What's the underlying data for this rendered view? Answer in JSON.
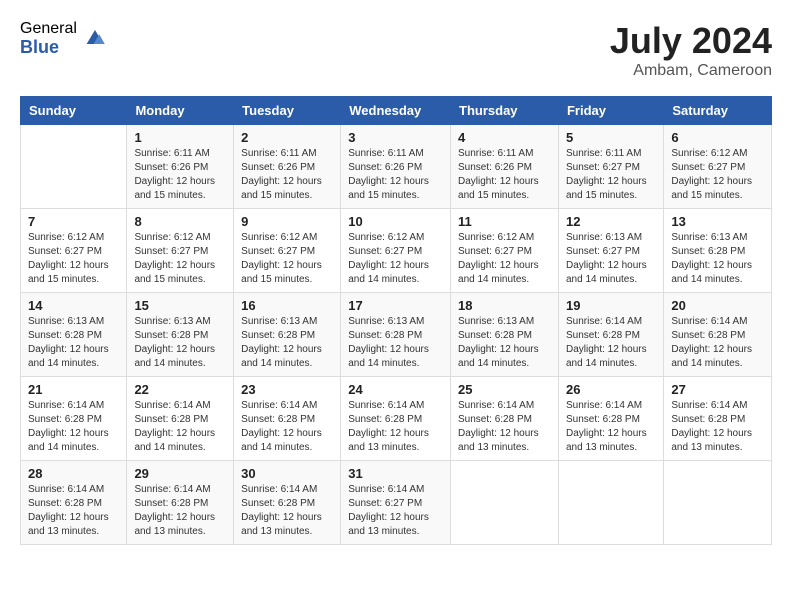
{
  "logo": {
    "general": "General",
    "blue": "Blue"
  },
  "title": "July 2024",
  "location": "Ambam, Cameroon",
  "days_of_week": [
    "Sunday",
    "Monday",
    "Tuesday",
    "Wednesday",
    "Thursday",
    "Friday",
    "Saturday"
  ],
  "weeks": [
    [
      {
        "day": "",
        "sunrise": "",
        "sunset": "",
        "daylight": ""
      },
      {
        "day": "1",
        "sunrise": "Sunrise: 6:11 AM",
        "sunset": "Sunset: 6:26 PM",
        "daylight": "Daylight: 12 hours and 15 minutes."
      },
      {
        "day": "2",
        "sunrise": "Sunrise: 6:11 AM",
        "sunset": "Sunset: 6:26 PM",
        "daylight": "Daylight: 12 hours and 15 minutes."
      },
      {
        "day": "3",
        "sunrise": "Sunrise: 6:11 AM",
        "sunset": "Sunset: 6:26 PM",
        "daylight": "Daylight: 12 hours and 15 minutes."
      },
      {
        "day": "4",
        "sunrise": "Sunrise: 6:11 AM",
        "sunset": "Sunset: 6:26 PM",
        "daylight": "Daylight: 12 hours and 15 minutes."
      },
      {
        "day": "5",
        "sunrise": "Sunrise: 6:11 AM",
        "sunset": "Sunset: 6:27 PM",
        "daylight": "Daylight: 12 hours and 15 minutes."
      },
      {
        "day": "6",
        "sunrise": "Sunrise: 6:12 AM",
        "sunset": "Sunset: 6:27 PM",
        "daylight": "Daylight: 12 hours and 15 minutes."
      }
    ],
    [
      {
        "day": "7",
        "sunrise": "Sunrise: 6:12 AM",
        "sunset": "Sunset: 6:27 PM",
        "daylight": "Daylight: 12 hours and 15 minutes."
      },
      {
        "day": "8",
        "sunrise": "Sunrise: 6:12 AM",
        "sunset": "Sunset: 6:27 PM",
        "daylight": "Daylight: 12 hours and 15 minutes."
      },
      {
        "day": "9",
        "sunrise": "Sunrise: 6:12 AM",
        "sunset": "Sunset: 6:27 PM",
        "daylight": "Daylight: 12 hours and 15 minutes."
      },
      {
        "day": "10",
        "sunrise": "Sunrise: 6:12 AM",
        "sunset": "Sunset: 6:27 PM",
        "daylight": "Daylight: 12 hours and 14 minutes."
      },
      {
        "day": "11",
        "sunrise": "Sunrise: 6:12 AM",
        "sunset": "Sunset: 6:27 PM",
        "daylight": "Daylight: 12 hours and 14 minutes."
      },
      {
        "day": "12",
        "sunrise": "Sunrise: 6:13 AM",
        "sunset": "Sunset: 6:27 PM",
        "daylight": "Daylight: 12 hours and 14 minutes."
      },
      {
        "day": "13",
        "sunrise": "Sunrise: 6:13 AM",
        "sunset": "Sunset: 6:28 PM",
        "daylight": "Daylight: 12 hours and 14 minutes."
      }
    ],
    [
      {
        "day": "14",
        "sunrise": "Sunrise: 6:13 AM",
        "sunset": "Sunset: 6:28 PM",
        "daylight": "Daylight: 12 hours and 14 minutes."
      },
      {
        "day": "15",
        "sunrise": "Sunrise: 6:13 AM",
        "sunset": "Sunset: 6:28 PM",
        "daylight": "Daylight: 12 hours and 14 minutes."
      },
      {
        "day": "16",
        "sunrise": "Sunrise: 6:13 AM",
        "sunset": "Sunset: 6:28 PM",
        "daylight": "Daylight: 12 hours and 14 minutes."
      },
      {
        "day": "17",
        "sunrise": "Sunrise: 6:13 AM",
        "sunset": "Sunset: 6:28 PM",
        "daylight": "Daylight: 12 hours and 14 minutes."
      },
      {
        "day": "18",
        "sunrise": "Sunrise: 6:13 AM",
        "sunset": "Sunset: 6:28 PM",
        "daylight": "Daylight: 12 hours and 14 minutes."
      },
      {
        "day": "19",
        "sunrise": "Sunrise: 6:14 AM",
        "sunset": "Sunset: 6:28 PM",
        "daylight": "Daylight: 12 hours and 14 minutes."
      },
      {
        "day": "20",
        "sunrise": "Sunrise: 6:14 AM",
        "sunset": "Sunset: 6:28 PM",
        "daylight": "Daylight: 12 hours and 14 minutes."
      }
    ],
    [
      {
        "day": "21",
        "sunrise": "Sunrise: 6:14 AM",
        "sunset": "Sunset: 6:28 PM",
        "daylight": "Daylight: 12 hours and 14 minutes."
      },
      {
        "day": "22",
        "sunrise": "Sunrise: 6:14 AM",
        "sunset": "Sunset: 6:28 PM",
        "daylight": "Daylight: 12 hours and 14 minutes."
      },
      {
        "day": "23",
        "sunrise": "Sunrise: 6:14 AM",
        "sunset": "Sunset: 6:28 PM",
        "daylight": "Daylight: 12 hours and 14 minutes."
      },
      {
        "day": "24",
        "sunrise": "Sunrise: 6:14 AM",
        "sunset": "Sunset: 6:28 PM",
        "daylight": "Daylight: 12 hours and 13 minutes."
      },
      {
        "day": "25",
        "sunrise": "Sunrise: 6:14 AM",
        "sunset": "Sunset: 6:28 PM",
        "daylight": "Daylight: 12 hours and 13 minutes."
      },
      {
        "day": "26",
        "sunrise": "Sunrise: 6:14 AM",
        "sunset": "Sunset: 6:28 PM",
        "daylight": "Daylight: 12 hours and 13 minutes."
      },
      {
        "day": "27",
        "sunrise": "Sunrise: 6:14 AM",
        "sunset": "Sunset: 6:28 PM",
        "daylight": "Daylight: 12 hours and 13 minutes."
      }
    ],
    [
      {
        "day": "28",
        "sunrise": "Sunrise: 6:14 AM",
        "sunset": "Sunset: 6:28 PM",
        "daylight": "Daylight: 12 hours and 13 minutes."
      },
      {
        "day": "29",
        "sunrise": "Sunrise: 6:14 AM",
        "sunset": "Sunset: 6:28 PM",
        "daylight": "Daylight: 12 hours and 13 minutes."
      },
      {
        "day": "30",
        "sunrise": "Sunrise: 6:14 AM",
        "sunset": "Sunset: 6:28 PM",
        "daylight": "Daylight: 12 hours and 13 minutes."
      },
      {
        "day": "31",
        "sunrise": "Sunrise: 6:14 AM",
        "sunset": "Sunset: 6:27 PM",
        "daylight": "Daylight: 12 hours and 13 minutes."
      },
      {
        "day": "",
        "sunrise": "",
        "sunset": "",
        "daylight": ""
      },
      {
        "day": "",
        "sunrise": "",
        "sunset": "",
        "daylight": ""
      },
      {
        "day": "",
        "sunrise": "",
        "sunset": "",
        "daylight": ""
      }
    ]
  ]
}
